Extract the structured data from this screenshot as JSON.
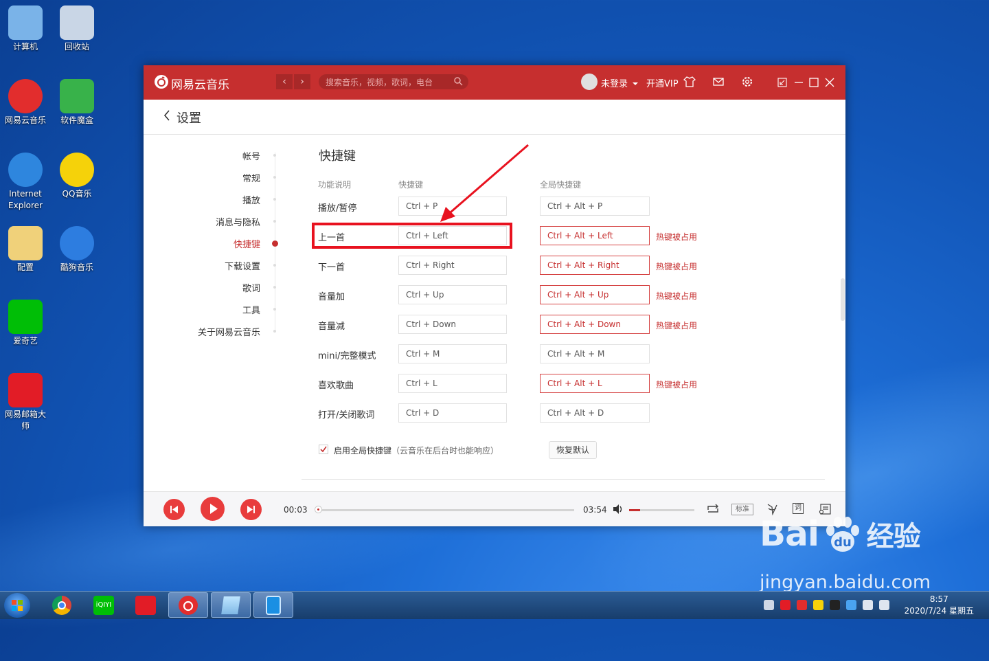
{
  "desktop": {
    "icons": [
      {
        "label": "计算机",
        "icon": "computer-icon"
      },
      {
        "label": "回收站",
        "icon": "recycle-bin-icon"
      },
      {
        "label": "网易云音乐",
        "icon": "netease-music-icon"
      },
      {
        "label": "软件魔盒",
        "icon": "software-box-icon"
      },
      {
        "label": "Internet Explorer",
        "icon": "ie-icon"
      },
      {
        "label": "QQ音乐",
        "icon": "qq-music-icon"
      },
      {
        "label": "配置",
        "icon": "folder-icon"
      },
      {
        "label": "酷狗音乐",
        "icon": "kugou-icon"
      },
      {
        "label": "爱奇艺",
        "icon": "iqiyi-icon"
      },
      {
        "label": "网易邮箱大师",
        "icon": "mail-master-icon"
      }
    ]
  },
  "window": {
    "app_name": "网易云音乐",
    "search_placeholder": "搜索音乐，视频，歌词，电台",
    "user_label": "未登录",
    "vip_label": "开通VIP",
    "page_title": "设置",
    "colors": {
      "accent": "#c62f2f",
      "conflict": "#c62f2f",
      "highlight": "#e8121f"
    }
  },
  "settings_nav": [
    {
      "label": "帐号",
      "active": false
    },
    {
      "label": "常规",
      "active": false
    },
    {
      "label": "播放",
      "active": false
    },
    {
      "label": "消息与隐私",
      "active": false
    },
    {
      "label": "快捷键",
      "active": true
    },
    {
      "label": "下载设置",
      "active": false
    },
    {
      "label": "歌词",
      "active": false
    },
    {
      "label": "工具",
      "active": false
    },
    {
      "label": "关于网易云音乐",
      "active": false
    }
  ],
  "shortcuts": {
    "section_title": "快捷键",
    "headers": {
      "function": "功能说明",
      "shortcut": "快捷键",
      "global": "全局快捷键"
    },
    "conflict_label": "热键被占用",
    "rows": [
      {
        "function": "播放/暂停",
        "shortcut": "Ctrl + P",
        "global": "Ctrl + Alt + P",
        "conflict": false
      },
      {
        "function": "上一首",
        "shortcut": "Ctrl + Left",
        "global": "Ctrl + Alt + Left",
        "conflict": true
      },
      {
        "function": "下一首",
        "shortcut": "Ctrl + Right",
        "global": "Ctrl + Alt + Right",
        "conflict": true
      },
      {
        "function": "音量加",
        "shortcut": "Ctrl + Up",
        "global": "Ctrl + Alt + Up",
        "conflict": true
      },
      {
        "function": "音量减",
        "shortcut": "Ctrl + Down",
        "global": "Ctrl + Alt + Down",
        "conflict": true
      },
      {
        "function": "mini/完整模式",
        "shortcut": "Ctrl + M",
        "global": "Ctrl + Alt + M",
        "conflict": false
      },
      {
        "function": "喜欢歌曲",
        "shortcut": "Ctrl + L",
        "global": "Ctrl + Alt + L",
        "conflict": true
      },
      {
        "function": "打开/关闭歌词",
        "shortcut": "Ctrl + D",
        "global": "Ctrl + Alt + D",
        "conflict": false
      }
    ],
    "enable_global_label": "启用全局快捷键",
    "enable_global_note": "（云音乐在后台时也能响应）",
    "enable_global_checked": true,
    "reset_label": "恢复默认"
  },
  "player": {
    "elapsed": "00:03",
    "duration": "03:54",
    "progress_fraction": 0.013,
    "volume_fraction": 0.17,
    "quality_label": "标准",
    "lyrics_label": "词"
  },
  "taskbar": {
    "time": "8:57",
    "date": "2020/7/24 星期五"
  },
  "watermark": {
    "brand": "Bai",
    "brand_suffix": "经验",
    "url": "jingyan.baidu.com"
  }
}
